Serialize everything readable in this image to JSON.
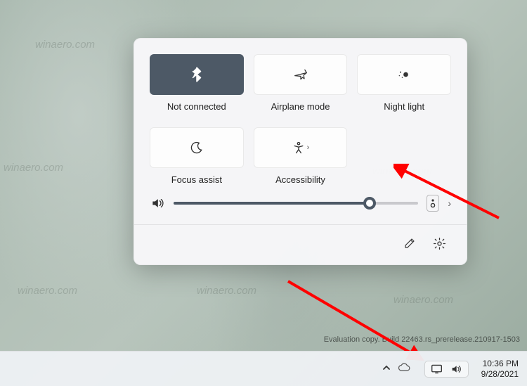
{
  "watermark": "winaero.com",
  "quick_settings": {
    "tiles": [
      {
        "label": "Not connected",
        "icon": "bluetooth",
        "active": true
      },
      {
        "label": "Airplane mode",
        "icon": "airplane",
        "active": false
      },
      {
        "label": "Night light",
        "icon": "nightlight",
        "active": false
      },
      {
        "label": "Focus assist",
        "icon": "moon",
        "active": false
      },
      {
        "label": "Accessibility",
        "icon": "accessibility",
        "active": false,
        "has_flyout": true
      }
    ],
    "volume": {
      "percent": 80
    },
    "footer": {
      "edit": "Edit quick settings",
      "settings": "Settings"
    }
  },
  "evaluation_line": "Evaluation copy. Build 22463.rs_prerelease.210917-1503",
  "taskbar": {
    "tray_overflow_icon": "chevron-up",
    "tray_icons": [
      "onedrive"
    ],
    "system_icons": [
      "network",
      "volume"
    ],
    "time": "10:36 PM",
    "date": "9/28/2021"
  },
  "annotation": {
    "arrows_to": [
      "accessibility-tile",
      "taskbar-system-tray"
    ],
    "color": "#ff0000"
  }
}
